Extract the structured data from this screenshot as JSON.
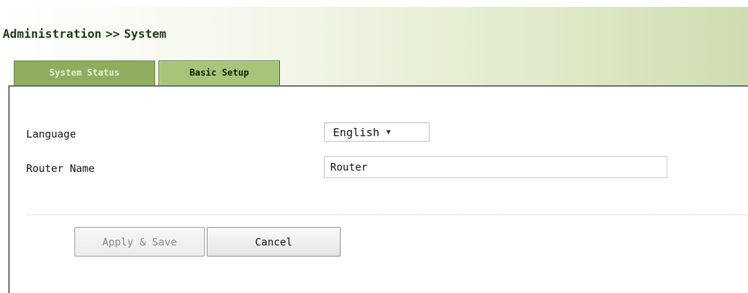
{
  "breadcrumb": {
    "section": "Administration",
    "separator": ">>",
    "page": "System"
  },
  "tabs": [
    {
      "label": "System Status",
      "active": false
    },
    {
      "label": "Basic Setup",
      "active": true
    }
  ],
  "form": {
    "language": {
      "label": "Language",
      "selected": "English",
      "arrow": "▼"
    },
    "router_name": {
      "label": "Router Name",
      "value": "Router"
    }
  },
  "actions": {
    "apply_label": "Apply & Save",
    "cancel_label": "Cancel"
  },
  "colors": {
    "tab_active_bg": "#a7c57a",
    "tab_inactive_bg": "#8fad5e",
    "header_gradient_end": "#cfdcb0"
  }
}
